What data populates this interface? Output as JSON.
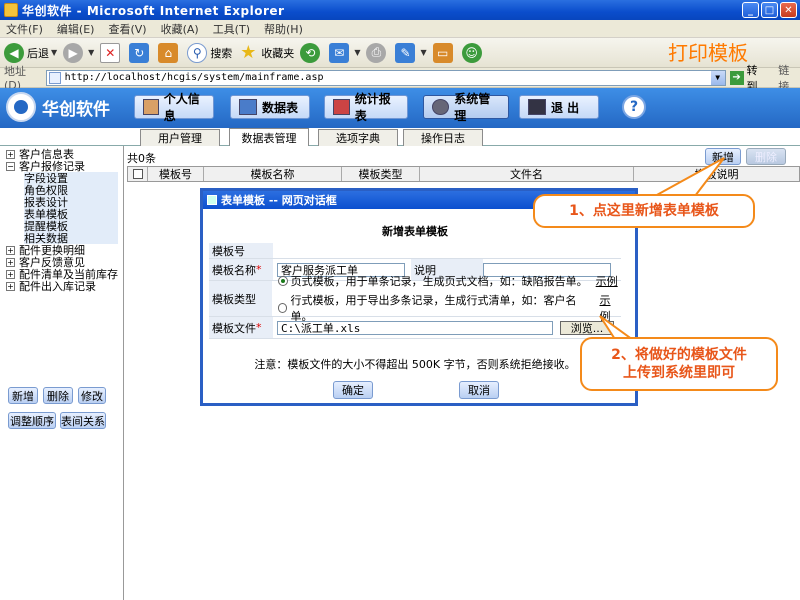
{
  "window": {
    "title": "华创软件 - Microsoft Internet Explorer",
    "buttons": [
      "_",
      "□",
      "✕"
    ]
  },
  "menu": [
    "文件(F)",
    "编辑(E)",
    "查看(V)",
    "收藏(A)",
    "工具(T)",
    "帮助(H)"
  ],
  "toolbar": {
    "back": "后退",
    "search": "搜索",
    "favorites": "收藏夹",
    "annotation": "打印模板"
  },
  "address": {
    "label": "地址(D)",
    "url": "http://localhost/hcgis/system/mainframe.asp",
    "go": "转到",
    "links": "链接"
  },
  "app": {
    "logo": "华创软件",
    "nav": [
      "个人信息",
      "数据表",
      "统计报表",
      "系统管理",
      "退 出"
    ],
    "help": "?"
  },
  "tabs": [
    "用户管理",
    "数据表管理",
    "选项字典",
    "操作日志"
  ],
  "tree": {
    "nodes": [
      {
        "label": "客户信息表",
        "sign": "+"
      },
      {
        "label": "客户报修记录",
        "sign": "−"
      }
    ],
    "children": [
      "字段设置",
      "角色权限",
      "报表设计",
      "表单模板",
      "提醒模板",
      "相关数据"
    ],
    "more": [
      {
        "label": "配件更换明细",
        "sign": "+"
      },
      {
        "label": "客户反馈意见",
        "sign": "+"
      },
      {
        "label": "配件清单及当前库存",
        "sign": "+"
      },
      {
        "label": "配件出入库记录",
        "sign": "+"
      }
    ]
  },
  "leftbuttons": [
    "新增",
    "删除",
    "修改",
    "调整顺序",
    "表间关系"
  ],
  "main": {
    "count": "共0条",
    "add": "新增",
    "delete": "删除",
    "columns": [
      "模板号",
      "模板名称",
      "模板类型",
      "文件名",
      "模板说明"
    ]
  },
  "dialog": {
    "title": "表单模板 -- 网页对话框",
    "heading": "新增表单模板",
    "labels": {
      "id": "模板号",
      "name": "模板名称",
      "desc": "说明",
      "type": "模板类型",
      "file": "模板文件"
    },
    "values": {
      "name": "客户服务派工单",
      "file": "C:\\派工单.xls"
    },
    "options": [
      "页式模板，用于单条记录，生成页式文档，如：缺陷报告单。",
      "行式模板，用于导出多条记录，生成行式清单，如：客户名单。"
    ],
    "example": "示例",
    "browse": "浏览...",
    "note": "注意：模板文件的大小不得超出 500K 字节，否则系统拒绝接收。",
    "ok": "确定",
    "cancel": "取消"
  },
  "callouts": {
    "one": "1、点这里新增表单模板",
    "two_line1": "2、将做好的模板文件",
    "two_line2": "上传到系统里即可"
  }
}
